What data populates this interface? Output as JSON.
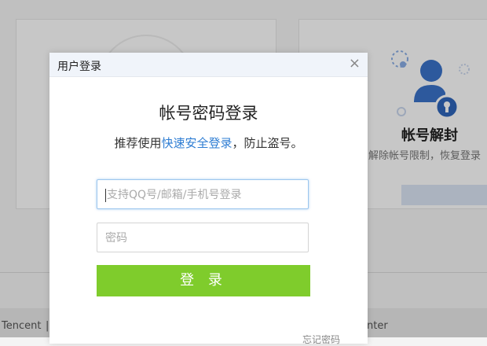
{
  "background": {
    "right_card": {
      "title": "帐号解封",
      "description": "解除帐号限制，恢复登录"
    },
    "footer": {
      "left_text": "Tencent",
      "separator": "|",
      "right_text": "nter"
    }
  },
  "dialog": {
    "header_title": "用户登录",
    "close_label": "×",
    "heading": "帐号密码登录",
    "subtitle_prefix": "推荐使用",
    "subtitle_link": "快速安全登录",
    "subtitle_suffix": "，防止盗号。",
    "username_placeholder": "支持QQ号/邮箱/手机号登录",
    "password_placeholder": "密码",
    "login_button": "登 录",
    "forgot_link": "忘记密码"
  },
  "colors": {
    "accent_green": "#7fcc2c",
    "link_blue": "#2e7dd3",
    "icon_blue": "#3a73c9"
  }
}
